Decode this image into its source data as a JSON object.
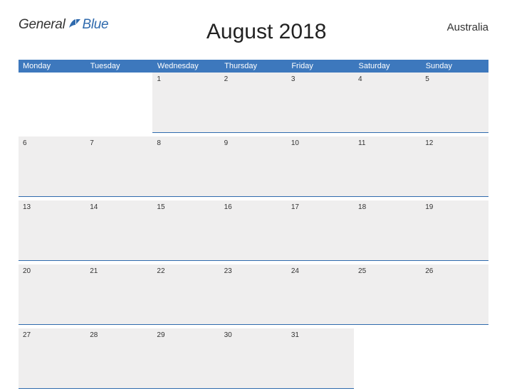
{
  "header": {
    "logo_general": "General",
    "logo_blue": "Blue",
    "title": "August 2018",
    "region": "Australia"
  },
  "days": [
    "Monday",
    "Tuesday",
    "Wednesday",
    "Thursday",
    "Friday",
    "Saturday",
    "Sunday"
  ],
  "weeks": [
    [
      "",
      "",
      "1",
      "2",
      "3",
      "4",
      "5"
    ],
    [
      "6",
      "7",
      "8",
      "9",
      "10",
      "11",
      "12"
    ],
    [
      "13",
      "14",
      "15",
      "16",
      "17",
      "18",
      "19"
    ],
    [
      "20",
      "21",
      "22",
      "23",
      "24",
      "25",
      "26"
    ],
    [
      "27",
      "28",
      "29",
      "30",
      "31",
      "",
      ""
    ]
  ]
}
